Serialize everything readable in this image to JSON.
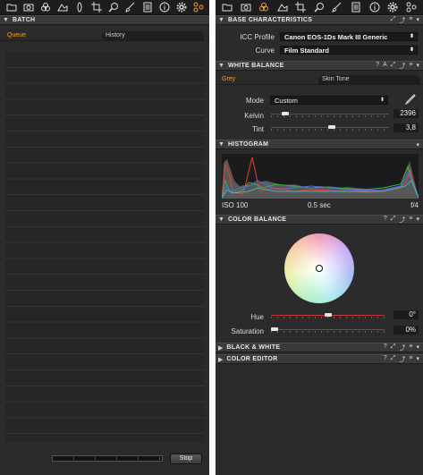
{
  "left_panel": {
    "batch": {
      "title": "BATCH"
    },
    "tabs": [
      {
        "label": "Queue"
      },
      {
        "label": "History"
      }
    ],
    "stop_button": "Stop",
    "progress": 0
  },
  "right_panel": {
    "base": {
      "title": "BASE CHARACTERISTICS",
      "icc_label": "ICC Profile",
      "icc_value": "Canon EOS-1Ds Mark III Generic",
      "curve_label": "Curve",
      "curve_value": "Film Standard"
    },
    "wb": {
      "title": "WHITE BALANCE",
      "tabs": [
        {
          "label": "Grey"
        },
        {
          "label": "Skin Tone"
        }
      ],
      "mode_label": "Mode",
      "mode_value": "Custom",
      "kelvin_label": "Kelvin",
      "kelvin_value": "2396",
      "kelvin_level": 0.1,
      "tint_label": "Tint",
      "tint_value": "3,8",
      "tint_level": 0.52
    },
    "histogram": {
      "title": "HISTOGRAM",
      "iso": "ISO 100",
      "shutter": "0.5 sec",
      "aperture": "f/4"
    },
    "color_balance": {
      "title": "COLOR BALANCE",
      "hue_label": "Hue",
      "hue_value": "0°",
      "hue_level": 0.5,
      "saturation_label": "Saturation",
      "saturation_value": "0%",
      "saturation_level": 0.0
    },
    "bw": {
      "title": "BLACK & WHITE"
    },
    "color_editor": {
      "title": "COLOR EDITOR"
    }
  },
  "toolbar_icons": [
    "folder-icon",
    "camera-icon",
    "color-circles-icon",
    "exposure-icon",
    "lens-icon",
    "crop-icon",
    "search-icon",
    "brush-icon",
    "metadata-icon",
    "info-icon",
    "gear-icon",
    "batch-icon"
  ],
  "colors": {
    "active_orange": "#f0a030",
    "panel_bg": "#2b2b2b",
    "header_bg": "#3a3a3a"
  }
}
